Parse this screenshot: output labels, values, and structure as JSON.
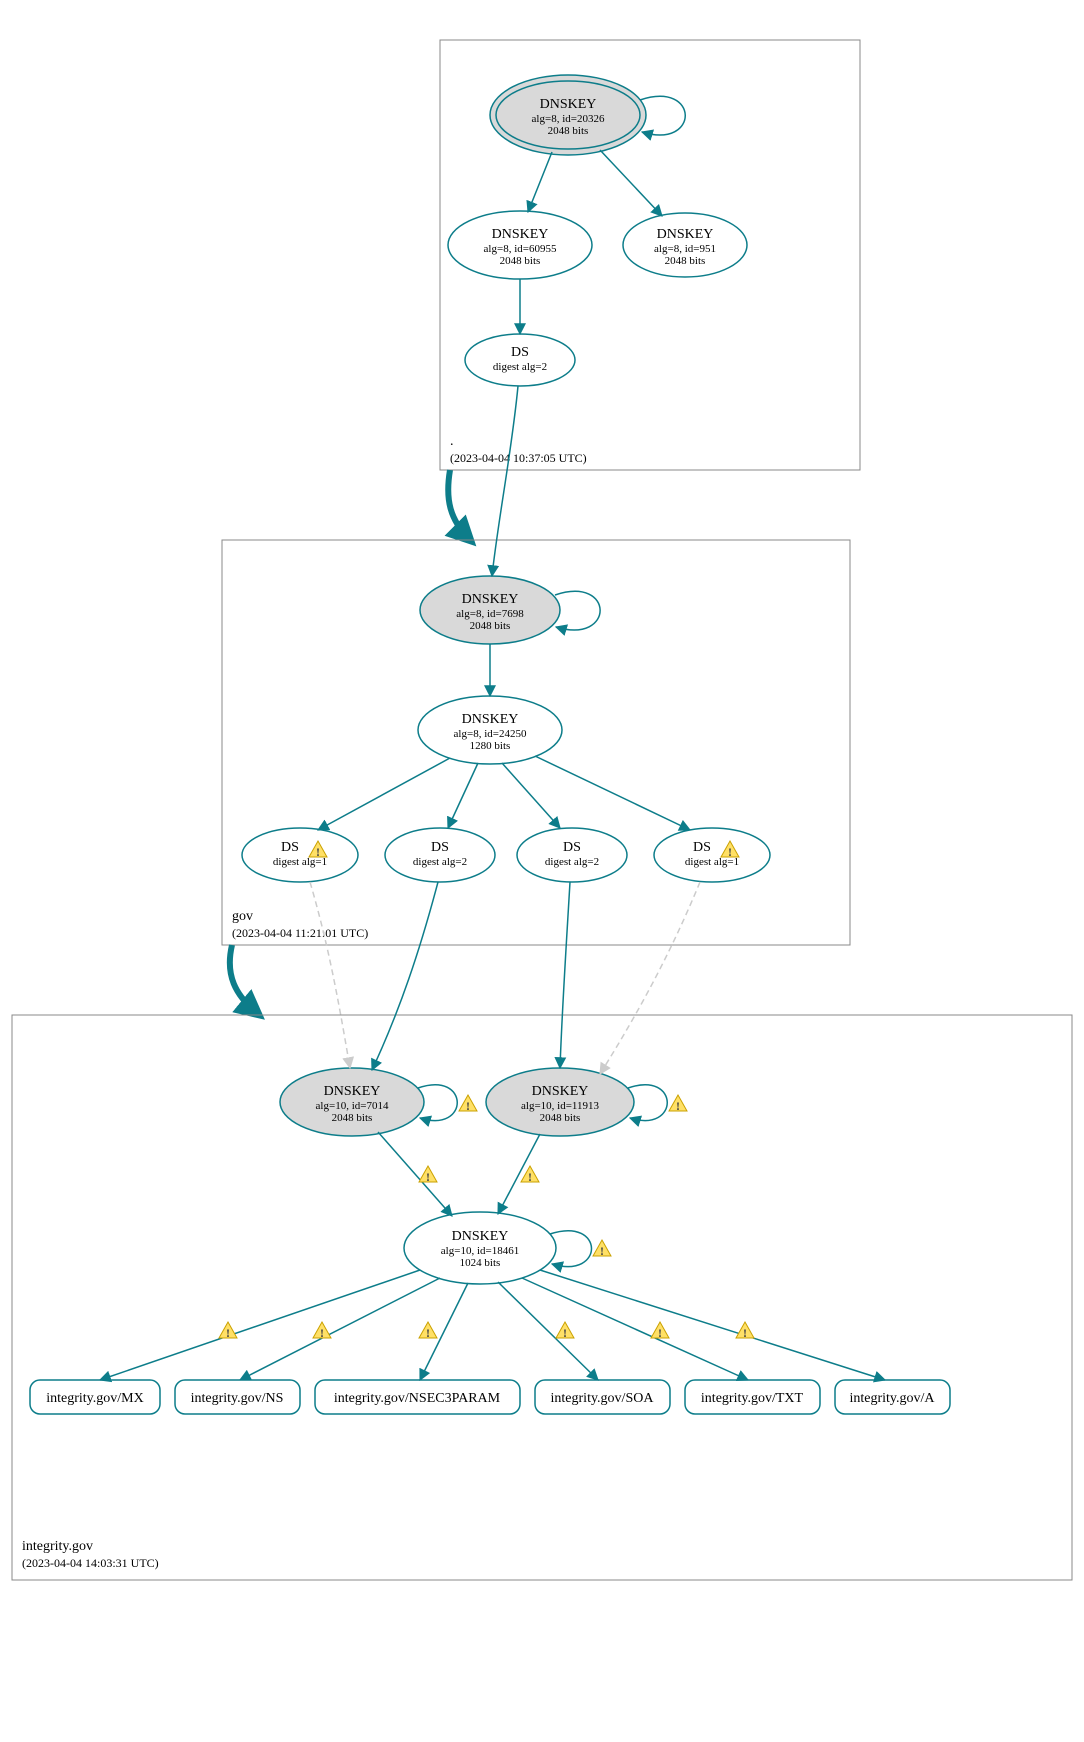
{
  "colors": {
    "stroke": "#0d7d8a",
    "kskFill": "#d9d9d9",
    "boxStroke": "#888888"
  },
  "zoneRoot": {
    "name": ".",
    "timestamp": "(2023-04-04 10:37:05 UTC)"
  },
  "zoneGov": {
    "name": "gov",
    "timestamp": "(2023-04-04 11:21:01 UTC)"
  },
  "zoneIntegrity": {
    "name": "integrity.gov",
    "timestamp": "(2023-04-04 14:03:31 UTC)"
  },
  "rootKsk": {
    "title": "DNSKEY",
    "sub1": "alg=8, id=20326",
    "sub2": "2048 bits"
  },
  "rootZsk1": {
    "title": "DNSKEY",
    "sub1": "alg=8, id=60955",
    "sub2": "2048 bits"
  },
  "rootZsk2": {
    "title": "DNSKEY",
    "sub1": "alg=8, id=951",
    "sub2": "2048 bits"
  },
  "rootDs": {
    "title": "DS",
    "sub1": "digest alg=2"
  },
  "govKsk": {
    "title": "DNSKEY",
    "sub1": "alg=8, id=7698",
    "sub2": "2048 bits"
  },
  "govZsk": {
    "title": "DNSKEY",
    "sub1": "alg=8, id=24250",
    "sub2": "1280 bits"
  },
  "govDs1": {
    "title": "DS",
    "sub1": "digest alg=1"
  },
  "govDs2": {
    "title": "DS",
    "sub1": "digest alg=2"
  },
  "govDs3": {
    "title": "DS",
    "sub1": "digest alg=2"
  },
  "govDs4": {
    "title": "DS",
    "sub1": "digest alg=1"
  },
  "intKsk1": {
    "title": "DNSKEY",
    "sub1": "alg=10, id=7014",
    "sub2": "2048 bits"
  },
  "intKsk2": {
    "title": "DNSKEY",
    "sub1": "alg=10, id=11913",
    "sub2": "2048 bits"
  },
  "intZsk": {
    "title": "DNSKEY",
    "sub1": "alg=10, id=18461",
    "sub2": "1024 bits"
  },
  "rrMX": "integrity.gov/MX",
  "rrNS": "integrity.gov/NS",
  "rrNSEC3": "integrity.gov/NSEC3PARAM",
  "rrSOA": "integrity.gov/SOA",
  "rrTXT": "integrity.gov/TXT",
  "rrA": "integrity.gov/A"
}
